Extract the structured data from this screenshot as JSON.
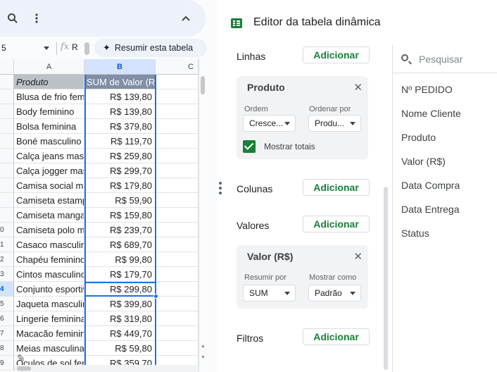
{
  "toolbar": {
    "summarize_label": "Resumir esta tabela"
  },
  "formula_bar": {
    "cell_ref": "5",
    "fx_symbol": "fx",
    "value": "R"
  },
  "sheet": {
    "col_headers": [
      "A",
      "B",
      "C"
    ],
    "selected_col": "B",
    "header_row": {
      "a": "Produto",
      "b": "SUM de Valor (R"
    },
    "row_numbers": [
      "",
      "",
      "",
      "",
      "",
      "",
      "",
      "",
      "",
      "",
      "0",
      "1",
      "2",
      "3",
      "4",
      "5",
      "6",
      "7",
      "8",
      "9",
      ""
    ],
    "selected_row_index": 14,
    "rows": [
      {
        "produto": "Blusa de frio feminina",
        "valor": "R$ 139,80"
      },
      {
        "produto": "Body feminino",
        "valor": "R$ 139,80"
      },
      {
        "produto": "Bolsa feminina",
        "valor": "R$ 379,80"
      },
      {
        "produto": "Boné masculino",
        "valor": "R$ 119,70"
      },
      {
        "produto": "Calça jeans masculina",
        "valor": "R$ 259,80"
      },
      {
        "produto": "Calça jogger masculina",
        "valor": "R$ 299,70"
      },
      {
        "produto": "Camisa social masculina",
        "valor": "R$ 179,80"
      },
      {
        "produto": "Camiseta estampada",
        "valor": "R$ 59,90"
      },
      {
        "produto": "Camiseta manga longa",
        "valor": "R$ 159,80"
      },
      {
        "produto": "Camiseta polo masculina",
        "valor": "R$ 239,70"
      },
      {
        "produto": "Casaco masculino",
        "valor": "R$ 689,70"
      },
      {
        "produto": "Chapéu feminino",
        "valor": "R$ 99,80"
      },
      {
        "produto": "Cintos masculinos",
        "valor": "R$ 179,70"
      },
      {
        "produto": "Conjunto esportivo",
        "valor": "R$ 299,80"
      },
      {
        "produto": "Jaqueta masculina",
        "valor": "R$ 399,80"
      },
      {
        "produto": "Lingerie feminina",
        "valor": "R$ 319,80"
      },
      {
        "produto": "Macacão feminino",
        "valor": "R$ 449,70"
      },
      {
        "produto": "Meias masculinas",
        "valor": "R$ 59,80"
      },
      {
        "produto": "Óculos de sol feminino",
        "valor": "R$ 359,70"
      }
    ]
  },
  "pivot": {
    "title": "Editor da tabela dinâmica",
    "add_label": "Adicionar",
    "rows_section": {
      "label": "Linhas",
      "card": {
        "title": "Produto",
        "order_label": "Ordem",
        "order_value": "Cresce...",
        "sort_by_label": "Ordenar por",
        "sort_by_value": "Produ...",
        "show_totals_label": "Mostrar totais",
        "show_totals_checked": true
      }
    },
    "columns_section": {
      "label": "Colunas"
    },
    "values_section": {
      "label": "Valores",
      "card": {
        "title": "Valor (R$)",
        "summarize_by_label": "Resumir por",
        "summarize_by_value": "SUM",
        "show_as_label": "Mostrar como",
        "show_as_value": "Padrão"
      }
    },
    "filters_section": {
      "label": "Filtros"
    },
    "search_placeholder": "Pesquisar",
    "fields": [
      "Nº PEDIDO",
      "Nome Cliente",
      "Produto",
      "Valor (R$)",
      "Data Compra",
      "Data Entrega",
      "Status"
    ]
  },
  "colors": {
    "accent_green": "#188038",
    "selection_blue": "#1a73e8",
    "header_b_bg": "#7f8fa6"
  }
}
